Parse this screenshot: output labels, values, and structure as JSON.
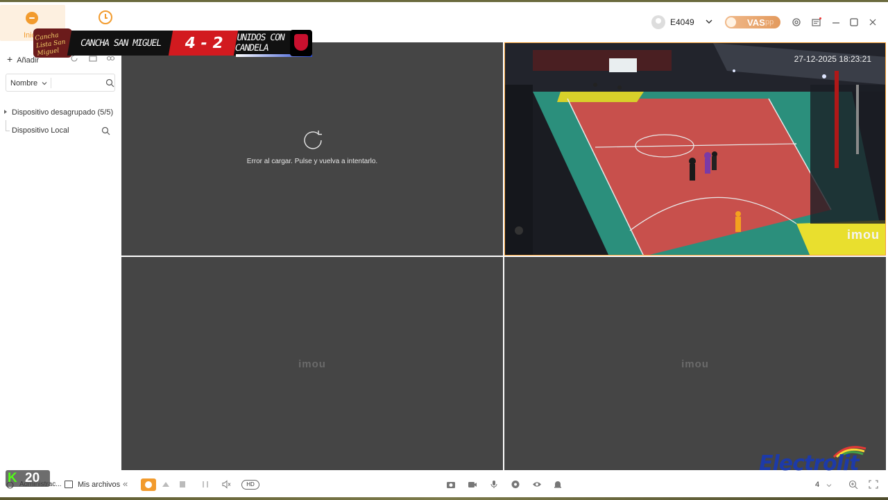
{
  "topbar": {
    "home_label": "Inicio",
    "user_name": "E4049",
    "vas_label": "VAS",
    "vas_sub": "pp"
  },
  "scoreboard": {
    "team_left": "CANCHA SAN MIGUEL",
    "score": "4 - 2",
    "team_right": "UNIDOS CON CANDELA",
    "logo_left_text": "Cancha Lista San Miguel"
  },
  "sidebar": {
    "add_label": "Añadir",
    "filter_select": "Nombre",
    "tree_group": "Dispositivo desagrupado (5/5)",
    "tree_local": "Dispositivo Local"
  },
  "grid": {
    "cell1_error": "Error al cargar. Pulse y vuelva a intentarlo.",
    "timestamp": "27-12-2025 18:23:21",
    "watermark": "imou",
    "cell3_logo": "imou",
    "cell4_logo": "imou"
  },
  "bottombar": {
    "admin_label": "Administrac...",
    "files_label": "Mis archivos",
    "collapse_glyph": "«",
    "hd_label": "HD",
    "grid_count": "4"
  },
  "overlay": {
    "kick_k": "K",
    "kick_count": "20",
    "brand_name": "Electrolit"
  },
  "colors": {
    "accent": "#f29b2d",
    "cell_bg": "#454545",
    "brand_blue": "#1d3aa8"
  },
  "icons": [
    "home-icon",
    "history-icon",
    "settings-icon",
    "message-icon",
    "minimize-icon",
    "maximize-icon",
    "close-icon",
    "search-icon",
    "retry-icon",
    "snapshot-icon",
    "record-icon",
    "mic-icon",
    "ptz-icon",
    "eye-icon",
    "bell-icon",
    "zoom-icon",
    "fullscreen-icon"
  ]
}
